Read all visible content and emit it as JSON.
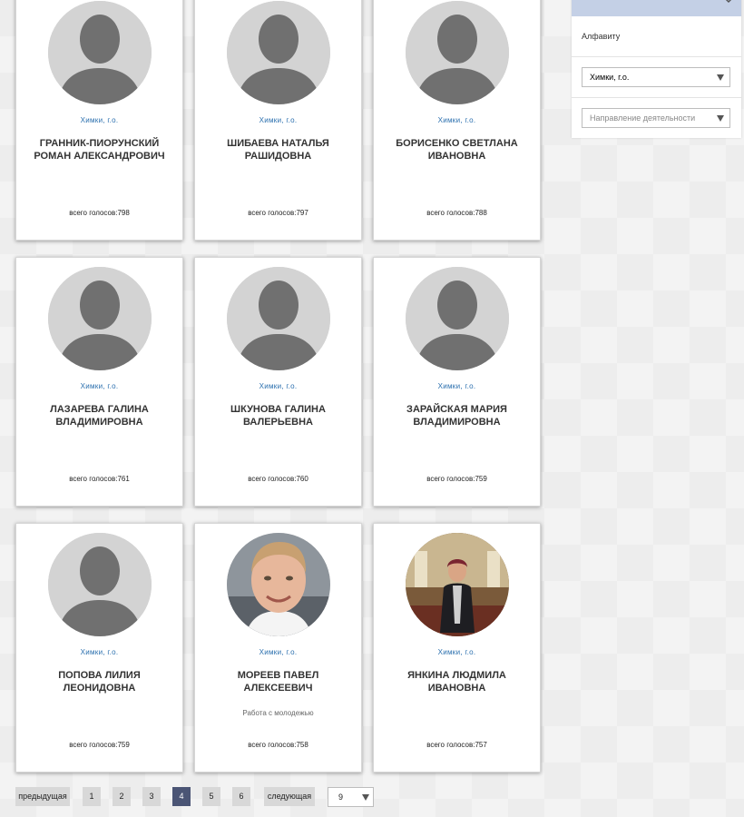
{
  "cards": [
    {
      "city": "Химки, г.о.",
      "name": "ГРАННИК-ПИОРУНСКИЙ РОМАН АЛЕКСАНДРОВИЧ",
      "category": "",
      "votes": "всего голосов:798",
      "avatar": "placeholder-avatar-icon"
    },
    {
      "city": "Химки, г.о.",
      "name": "ШИБАЕВА НАТАЛЬЯ РАШИДОВНА",
      "category": "",
      "votes": "всего голосов:797",
      "avatar": "placeholder-avatar-icon"
    },
    {
      "city": "Химки, г.о.",
      "name": "БОРИСЕНКО СВЕТЛАНА ИВАНОВНА",
      "category": "",
      "votes": "всего голосов:788",
      "avatar": "placeholder-avatar-icon"
    },
    {
      "city": "Химки, г.о.",
      "name": "ЛАЗАРЕВА ГАЛИНА ВЛАДИМИРОВНА",
      "category": "",
      "votes": "всего голосов:761",
      "avatar": "placeholder-avatar-icon"
    },
    {
      "city": "Химки, г.о.",
      "name": "ШКУНОВА ГАЛИНА ВАЛЕРЬЕВНА",
      "category": "",
      "votes": "всего голосов:760",
      "avatar": "placeholder-avatar-icon"
    },
    {
      "city": "Химки, г.о.",
      "name": "ЗАРАЙСКАЯ МАРИЯ ВЛАДИМИРОВНА",
      "category": "",
      "votes": "всего голосов:759",
      "avatar": "placeholder-avatar-icon"
    },
    {
      "city": "Химки, г.о.",
      "name": "ПОПОВА ЛИЛИЯ ЛЕОНИДОВНА",
      "category": "",
      "votes": "всего голосов:759",
      "avatar": "placeholder-avatar-icon"
    },
    {
      "city": "Химки, г.о.",
      "name": "МОРЕЕВ ПАВЕЛ АЛЕКСЕЕВИЧ",
      "category": "Работа с молодежью",
      "votes": "всего голосов:758",
      "avatar": "photo-young-man"
    },
    {
      "city": "Химки, г.о.",
      "name": "ЯНКИНА ЛЮДМИЛА ИВАНОВНА",
      "category": "",
      "votes": "всего голосов:757",
      "avatar": "photo-woman-hall"
    }
  ],
  "sidebar": {
    "sort_label": "Алфавиту",
    "city_select": "Химки, г.о.",
    "activity_select_placeholder": "Направление деятельности"
  },
  "pagination": {
    "prev": "предыдущая",
    "pages": [
      "1",
      "2",
      "3",
      "4",
      "5",
      "6"
    ],
    "active_page": "4",
    "next": "следующая",
    "per_page": "9"
  },
  "colors": {
    "link": "#2a6fae",
    "active_page": "#4b5575",
    "sidebar_header": "#c4d0e6"
  }
}
